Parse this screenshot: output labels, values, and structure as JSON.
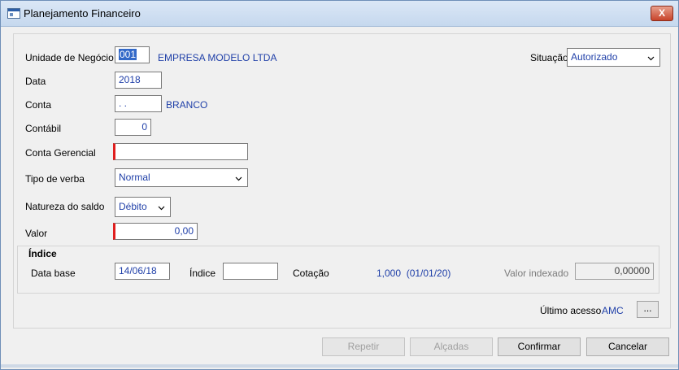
{
  "window": {
    "title": "Planejamento Financeiro",
    "close_label": "X"
  },
  "form": {
    "unidade": {
      "label": "Unidade de Negócio",
      "value": "001",
      "description": "EMPRESA MODELO LTDA"
    },
    "situacao": {
      "label": "Situação",
      "value": "Autorizado"
    },
    "data": {
      "label": "Data",
      "value": "2018"
    },
    "conta": {
      "label": "Conta",
      "value": ". .",
      "description": "BRANCO"
    },
    "contabil": {
      "label": "Contábil",
      "value": "0"
    },
    "conta_gerencial": {
      "label": "Conta Gerencial",
      "value": ""
    },
    "tipo_verba": {
      "label": "Tipo de verba",
      "value": "Normal"
    },
    "natureza": {
      "label": "Natureza do saldo",
      "value": "Débito"
    },
    "valor": {
      "label": "Valor",
      "value": "0,00"
    }
  },
  "indice": {
    "title": "Índice",
    "data_base": {
      "label": "Data base",
      "value": "14/06/18"
    },
    "indice": {
      "label": "Índice",
      "value": ""
    },
    "cotacao": {
      "label": "Cotação",
      "value": "1,000  (01/01/20)"
    },
    "valor_indexado": {
      "label": "Valor indexado",
      "value": "0,00000"
    }
  },
  "ultimo_acesso": {
    "label": "Último acesso",
    "value": "AMC",
    "button": "..."
  },
  "buttons": {
    "repetir": "Repetir",
    "alcadas": "Alçadas",
    "confirmar": "Confirmar",
    "cancelar": "Cancelar"
  },
  "colors": {
    "value_text": "#1f3fa8",
    "required_marker": "#e01e1e",
    "selection": "#3369c8"
  }
}
